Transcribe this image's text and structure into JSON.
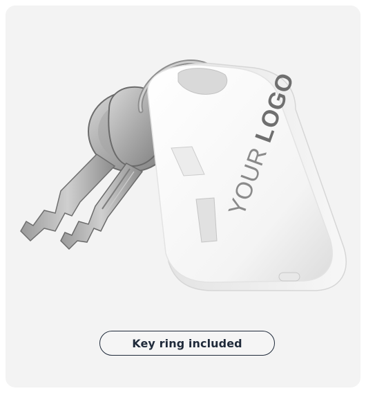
{
  "product": {
    "logo_light": "YOUR ",
    "logo_bold": "LOGO"
  },
  "badge": {
    "label": "Key ring included"
  },
  "colors": {
    "card_background": "#f3f3f3",
    "device_body": "#ffffff",
    "badge_border": "#1f2a3a",
    "badge_text": "#1f2a3a"
  }
}
